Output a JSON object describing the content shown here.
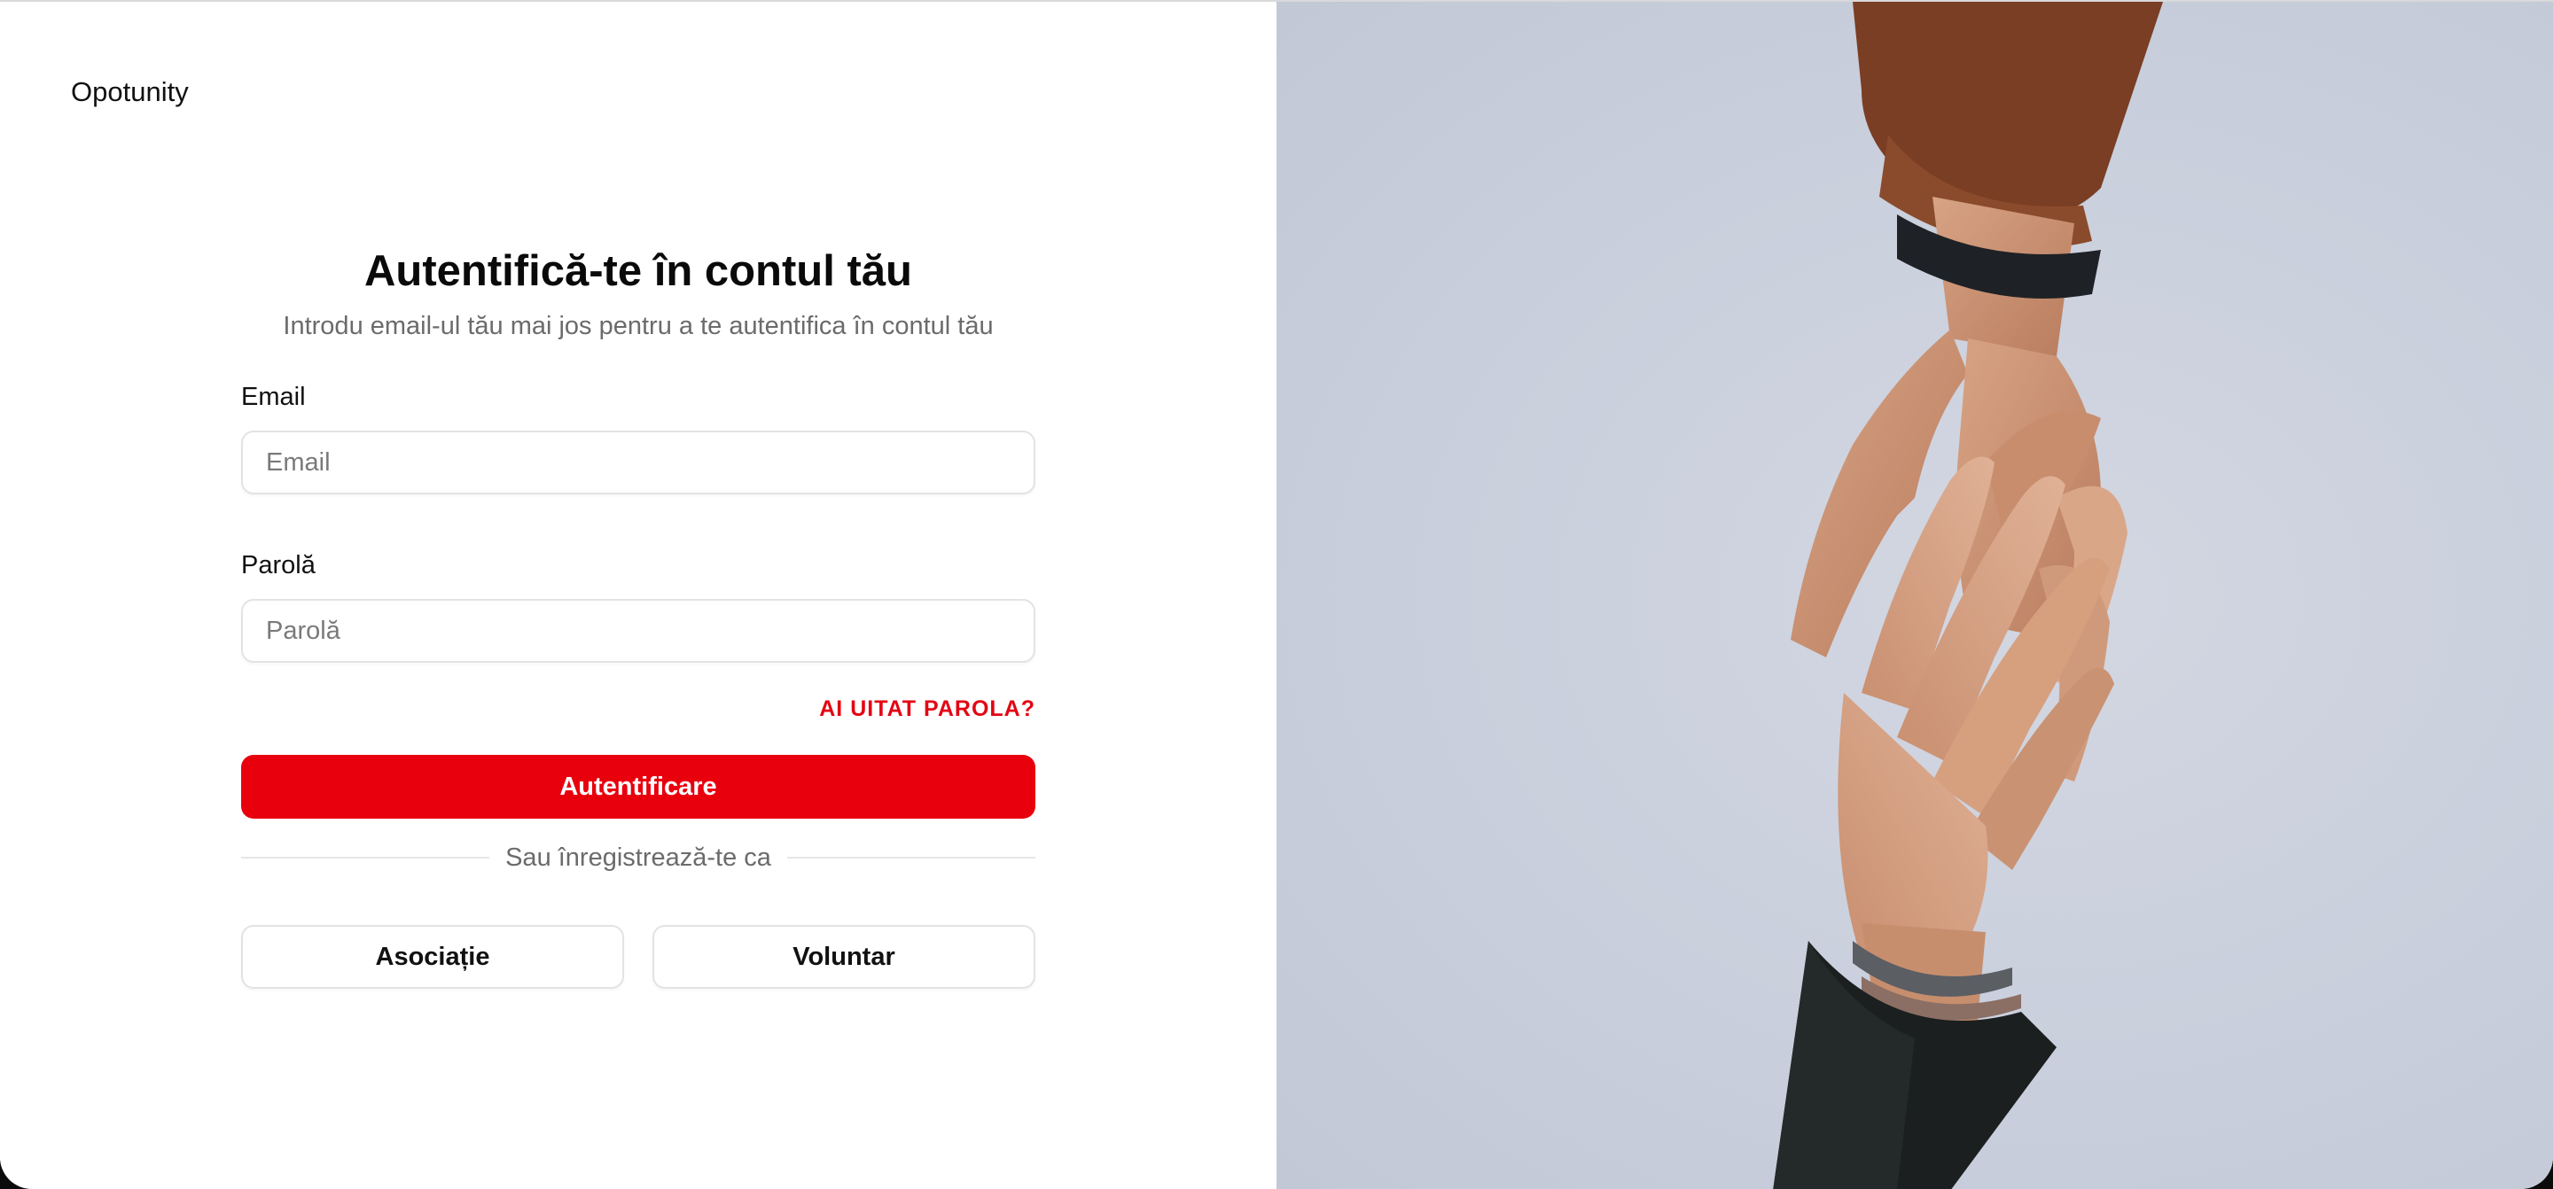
{
  "app": {
    "name": "Opotunity"
  },
  "login": {
    "heading": "Autentifică-te în contul tău",
    "subheading": "Introdu email-ul tău mai jos pentru a te autentifica în contul tău",
    "email_label": "Email",
    "email_placeholder": "Email",
    "password_label": "Parolă",
    "password_placeholder": "Parolă",
    "forgot_link": "AI UITAT PAROLA?",
    "submit_label": "Autentificare",
    "divider_text": "Sau înregistrează-te ca",
    "register_association_label": "Asociație",
    "register_volunteer_label": "Voluntar"
  },
  "colors": {
    "accent": "#e8000d",
    "link": "#e30613",
    "photo_background": "#c9cfdc"
  },
  "image": {
    "icon": "reaching-hands-photo"
  }
}
